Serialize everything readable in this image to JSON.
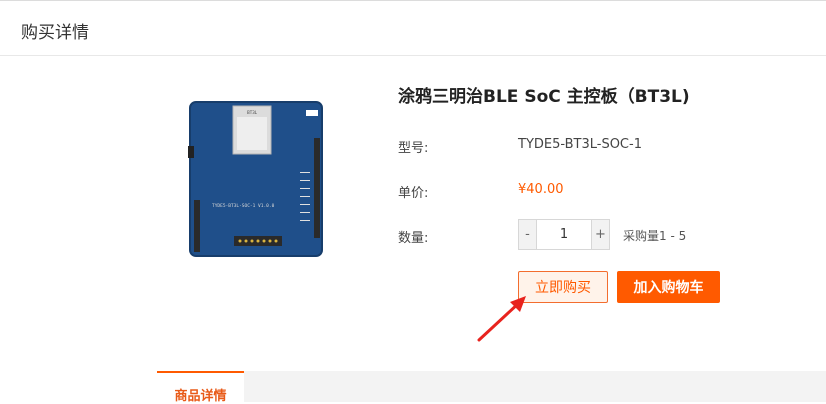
{
  "header": {
    "title": "购买详情"
  },
  "product": {
    "title": "涂鸦三明治BLE SoC 主控板（BT3L)",
    "model_label": "型号:",
    "model_value": "TYDE5-BT3L-SOC-1",
    "price_label": "单价:",
    "price_value": "¥40.00",
    "quantity_label": "数量:",
    "quantity_value": "1",
    "minus_label": "-",
    "plus_label": "+",
    "quantity_range": "采购量1 - 5",
    "board_silkscreen": "TYDE5-BT3L-SOC-1 V1.0.0",
    "module_label": "BT3L"
  },
  "actions": {
    "buy_now": "立即购买",
    "add_to_cart": "加入购物车"
  },
  "tabs": [
    {
      "label": "商品详情",
      "active": true
    }
  ],
  "colors": {
    "accent": "#ff5a00",
    "board": "#1f4f8a",
    "annotation_arrow": "#e8231e"
  }
}
